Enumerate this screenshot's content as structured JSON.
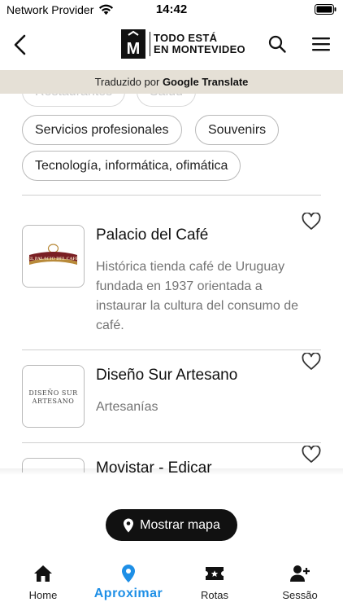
{
  "status_bar": {
    "carrier": "Network Provider",
    "time": "14:42"
  },
  "header": {
    "logo_line1": "TODO ESTÁ",
    "logo_line2": "EN MONTEVIDEO",
    "logo_letter": "M"
  },
  "translate_bar": {
    "prefix": "Traduzido por",
    "brand": "Google Translate"
  },
  "categories": {
    "partial_1": "Restaurantes",
    "partial_2": "Salud",
    "chip_1": "Servicios profesionales",
    "chip_2": "Souvenirs",
    "chip_3": "Tecnología, informática, ofimática"
  },
  "businesses": [
    {
      "name": "Palacio del Café",
      "description": "Histórica tienda café de Uruguay fundada en 1937 orientada a instaurar la cultura del consumo de café.",
      "logo_text": "EL PALACIO DEL CAFÉ"
    },
    {
      "name": "Diseño Sur Artesano",
      "description": "Artesanías",
      "logo_line1": "DISEÑO SUR",
      "logo_line2": "ARTESANO"
    },
    {
      "name": "Movistar - Edicar"
    }
  ],
  "map_button": {
    "label": "Mostrar mapa"
  },
  "tabbar": {
    "home": "Home",
    "nearby": "Aproximar",
    "routes": "Rotas",
    "session": "Sessão"
  },
  "colors": {
    "accent": "#1e8fe6",
    "translate_bar_bg": "#e5e0d6",
    "button_bg": "#111111"
  }
}
